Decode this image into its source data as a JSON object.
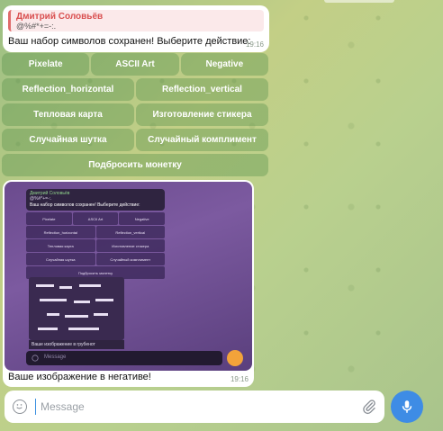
{
  "reply": {
    "name": "Дмитрий Соловьёв",
    "text": "@%#*+=-:."
  },
  "message1": {
    "text": "Ваш набор символов сохранен! Выберите действие:",
    "time": "19:16"
  },
  "keyboard": {
    "row1": [
      "Pixelate",
      "ASCII Art",
      "Negative"
    ],
    "row2": [
      "Reflection_horizontal",
      "Reflection_vertical"
    ],
    "row3": [
      "Тепловая карта",
      "Изготовление стикера"
    ],
    "row4": [
      "Случайная шутка",
      "Случайный комплимент"
    ],
    "row5": [
      "Подбросить монетку"
    ]
  },
  "photo_message": {
    "caption": "Ваше изображение в негативе!",
    "time": "19:16",
    "inner": {
      "name": "Дмитрий Соловьёв",
      "sub": "@%#*+=-:.",
      "text": "Ваш набор символов сохранен! Выберите действие:",
      "buttons_row1": [
        "Pixelate",
        "ASCII Art",
        "Negative"
      ],
      "buttons_row2": [
        "Reflection_horizontal",
        "Reflection_vertical"
      ],
      "buttons_row3": [
        "Тепловая карта",
        "Изготовление стикера"
      ],
      "buttons_row4": [
        "Случайная шутка",
        "Случайный комплимент"
      ],
      "buttons_row5": [
        "Подбросить монетку"
      ],
      "image_caption": "Ваше изображение в грубенот",
      "input_placeholder": "Message"
    }
  },
  "input": {
    "placeholder": "Message"
  },
  "colors": {
    "accent": "#3e8ce5",
    "reply_name": "#d94f4f",
    "keyboard_btn": "#6c9a5a"
  },
  "icons": {
    "emoji": "smile-icon",
    "attach": "paperclip-icon",
    "send": "microphone-icon"
  }
}
